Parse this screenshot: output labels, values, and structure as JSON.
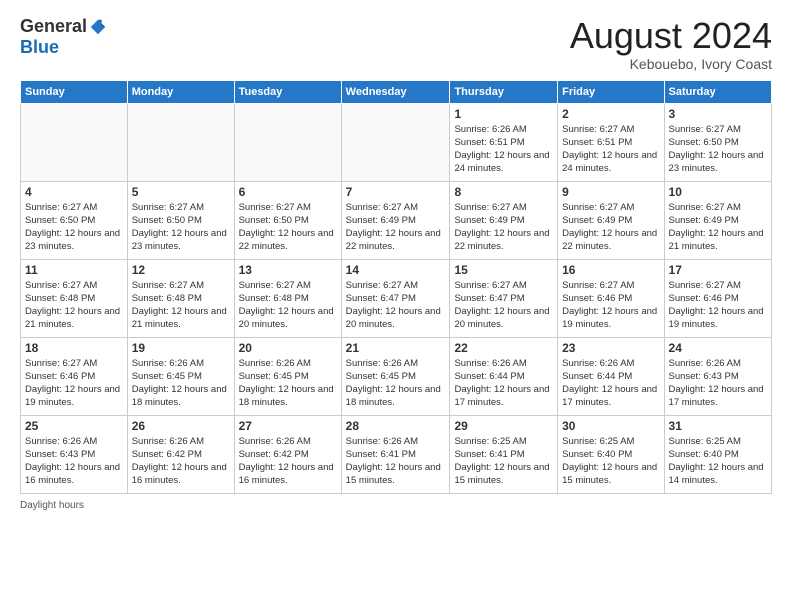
{
  "logo": {
    "general": "General",
    "blue": "Blue"
  },
  "title": "August 2024",
  "location": "Kebouebo, Ivory Coast",
  "days_of_week": [
    "Sunday",
    "Monday",
    "Tuesday",
    "Wednesday",
    "Thursday",
    "Friday",
    "Saturday"
  ],
  "footer": "Daylight hours",
  "weeks": [
    [
      {
        "day": "",
        "info": ""
      },
      {
        "day": "",
        "info": ""
      },
      {
        "day": "",
        "info": ""
      },
      {
        "day": "",
        "info": ""
      },
      {
        "day": "1",
        "info": "Sunrise: 6:26 AM\nSunset: 6:51 PM\nDaylight: 12 hours and 24 minutes."
      },
      {
        "day": "2",
        "info": "Sunrise: 6:27 AM\nSunset: 6:51 PM\nDaylight: 12 hours and 24 minutes."
      },
      {
        "day": "3",
        "info": "Sunrise: 6:27 AM\nSunset: 6:50 PM\nDaylight: 12 hours and 23 minutes."
      }
    ],
    [
      {
        "day": "4",
        "info": "Sunrise: 6:27 AM\nSunset: 6:50 PM\nDaylight: 12 hours and 23 minutes."
      },
      {
        "day": "5",
        "info": "Sunrise: 6:27 AM\nSunset: 6:50 PM\nDaylight: 12 hours and 23 minutes."
      },
      {
        "day": "6",
        "info": "Sunrise: 6:27 AM\nSunset: 6:50 PM\nDaylight: 12 hours and 22 minutes."
      },
      {
        "day": "7",
        "info": "Sunrise: 6:27 AM\nSunset: 6:49 PM\nDaylight: 12 hours and 22 minutes."
      },
      {
        "day": "8",
        "info": "Sunrise: 6:27 AM\nSunset: 6:49 PM\nDaylight: 12 hours and 22 minutes."
      },
      {
        "day": "9",
        "info": "Sunrise: 6:27 AM\nSunset: 6:49 PM\nDaylight: 12 hours and 22 minutes."
      },
      {
        "day": "10",
        "info": "Sunrise: 6:27 AM\nSunset: 6:49 PM\nDaylight: 12 hours and 21 minutes."
      }
    ],
    [
      {
        "day": "11",
        "info": "Sunrise: 6:27 AM\nSunset: 6:48 PM\nDaylight: 12 hours and 21 minutes."
      },
      {
        "day": "12",
        "info": "Sunrise: 6:27 AM\nSunset: 6:48 PM\nDaylight: 12 hours and 21 minutes."
      },
      {
        "day": "13",
        "info": "Sunrise: 6:27 AM\nSunset: 6:48 PM\nDaylight: 12 hours and 20 minutes."
      },
      {
        "day": "14",
        "info": "Sunrise: 6:27 AM\nSunset: 6:47 PM\nDaylight: 12 hours and 20 minutes."
      },
      {
        "day": "15",
        "info": "Sunrise: 6:27 AM\nSunset: 6:47 PM\nDaylight: 12 hours and 20 minutes."
      },
      {
        "day": "16",
        "info": "Sunrise: 6:27 AM\nSunset: 6:46 PM\nDaylight: 12 hours and 19 minutes."
      },
      {
        "day": "17",
        "info": "Sunrise: 6:27 AM\nSunset: 6:46 PM\nDaylight: 12 hours and 19 minutes."
      }
    ],
    [
      {
        "day": "18",
        "info": "Sunrise: 6:27 AM\nSunset: 6:46 PM\nDaylight: 12 hours and 19 minutes."
      },
      {
        "day": "19",
        "info": "Sunrise: 6:26 AM\nSunset: 6:45 PM\nDaylight: 12 hours and 18 minutes."
      },
      {
        "day": "20",
        "info": "Sunrise: 6:26 AM\nSunset: 6:45 PM\nDaylight: 12 hours and 18 minutes."
      },
      {
        "day": "21",
        "info": "Sunrise: 6:26 AM\nSunset: 6:45 PM\nDaylight: 12 hours and 18 minutes."
      },
      {
        "day": "22",
        "info": "Sunrise: 6:26 AM\nSunset: 6:44 PM\nDaylight: 12 hours and 17 minutes."
      },
      {
        "day": "23",
        "info": "Sunrise: 6:26 AM\nSunset: 6:44 PM\nDaylight: 12 hours and 17 minutes."
      },
      {
        "day": "24",
        "info": "Sunrise: 6:26 AM\nSunset: 6:43 PM\nDaylight: 12 hours and 17 minutes."
      }
    ],
    [
      {
        "day": "25",
        "info": "Sunrise: 6:26 AM\nSunset: 6:43 PM\nDaylight: 12 hours and 16 minutes."
      },
      {
        "day": "26",
        "info": "Sunrise: 6:26 AM\nSunset: 6:42 PM\nDaylight: 12 hours and 16 minutes."
      },
      {
        "day": "27",
        "info": "Sunrise: 6:26 AM\nSunset: 6:42 PM\nDaylight: 12 hours and 16 minutes."
      },
      {
        "day": "28",
        "info": "Sunrise: 6:26 AM\nSunset: 6:41 PM\nDaylight: 12 hours and 15 minutes."
      },
      {
        "day": "29",
        "info": "Sunrise: 6:25 AM\nSunset: 6:41 PM\nDaylight: 12 hours and 15 minutes."
      },
      {
        "day": "30",
        "info": "Sunrise: 6:25 AM\nSunset: 6:40 PM\nDaylight: 12 hours and 15 minutes."
      },
      {
        "day": "31",
        "info": "Sunrise: 6:25 AM\nSunset: 6:40 PM\nDaylight: 12 hours and 14 minutes."
      }
    ]
  ]
}
